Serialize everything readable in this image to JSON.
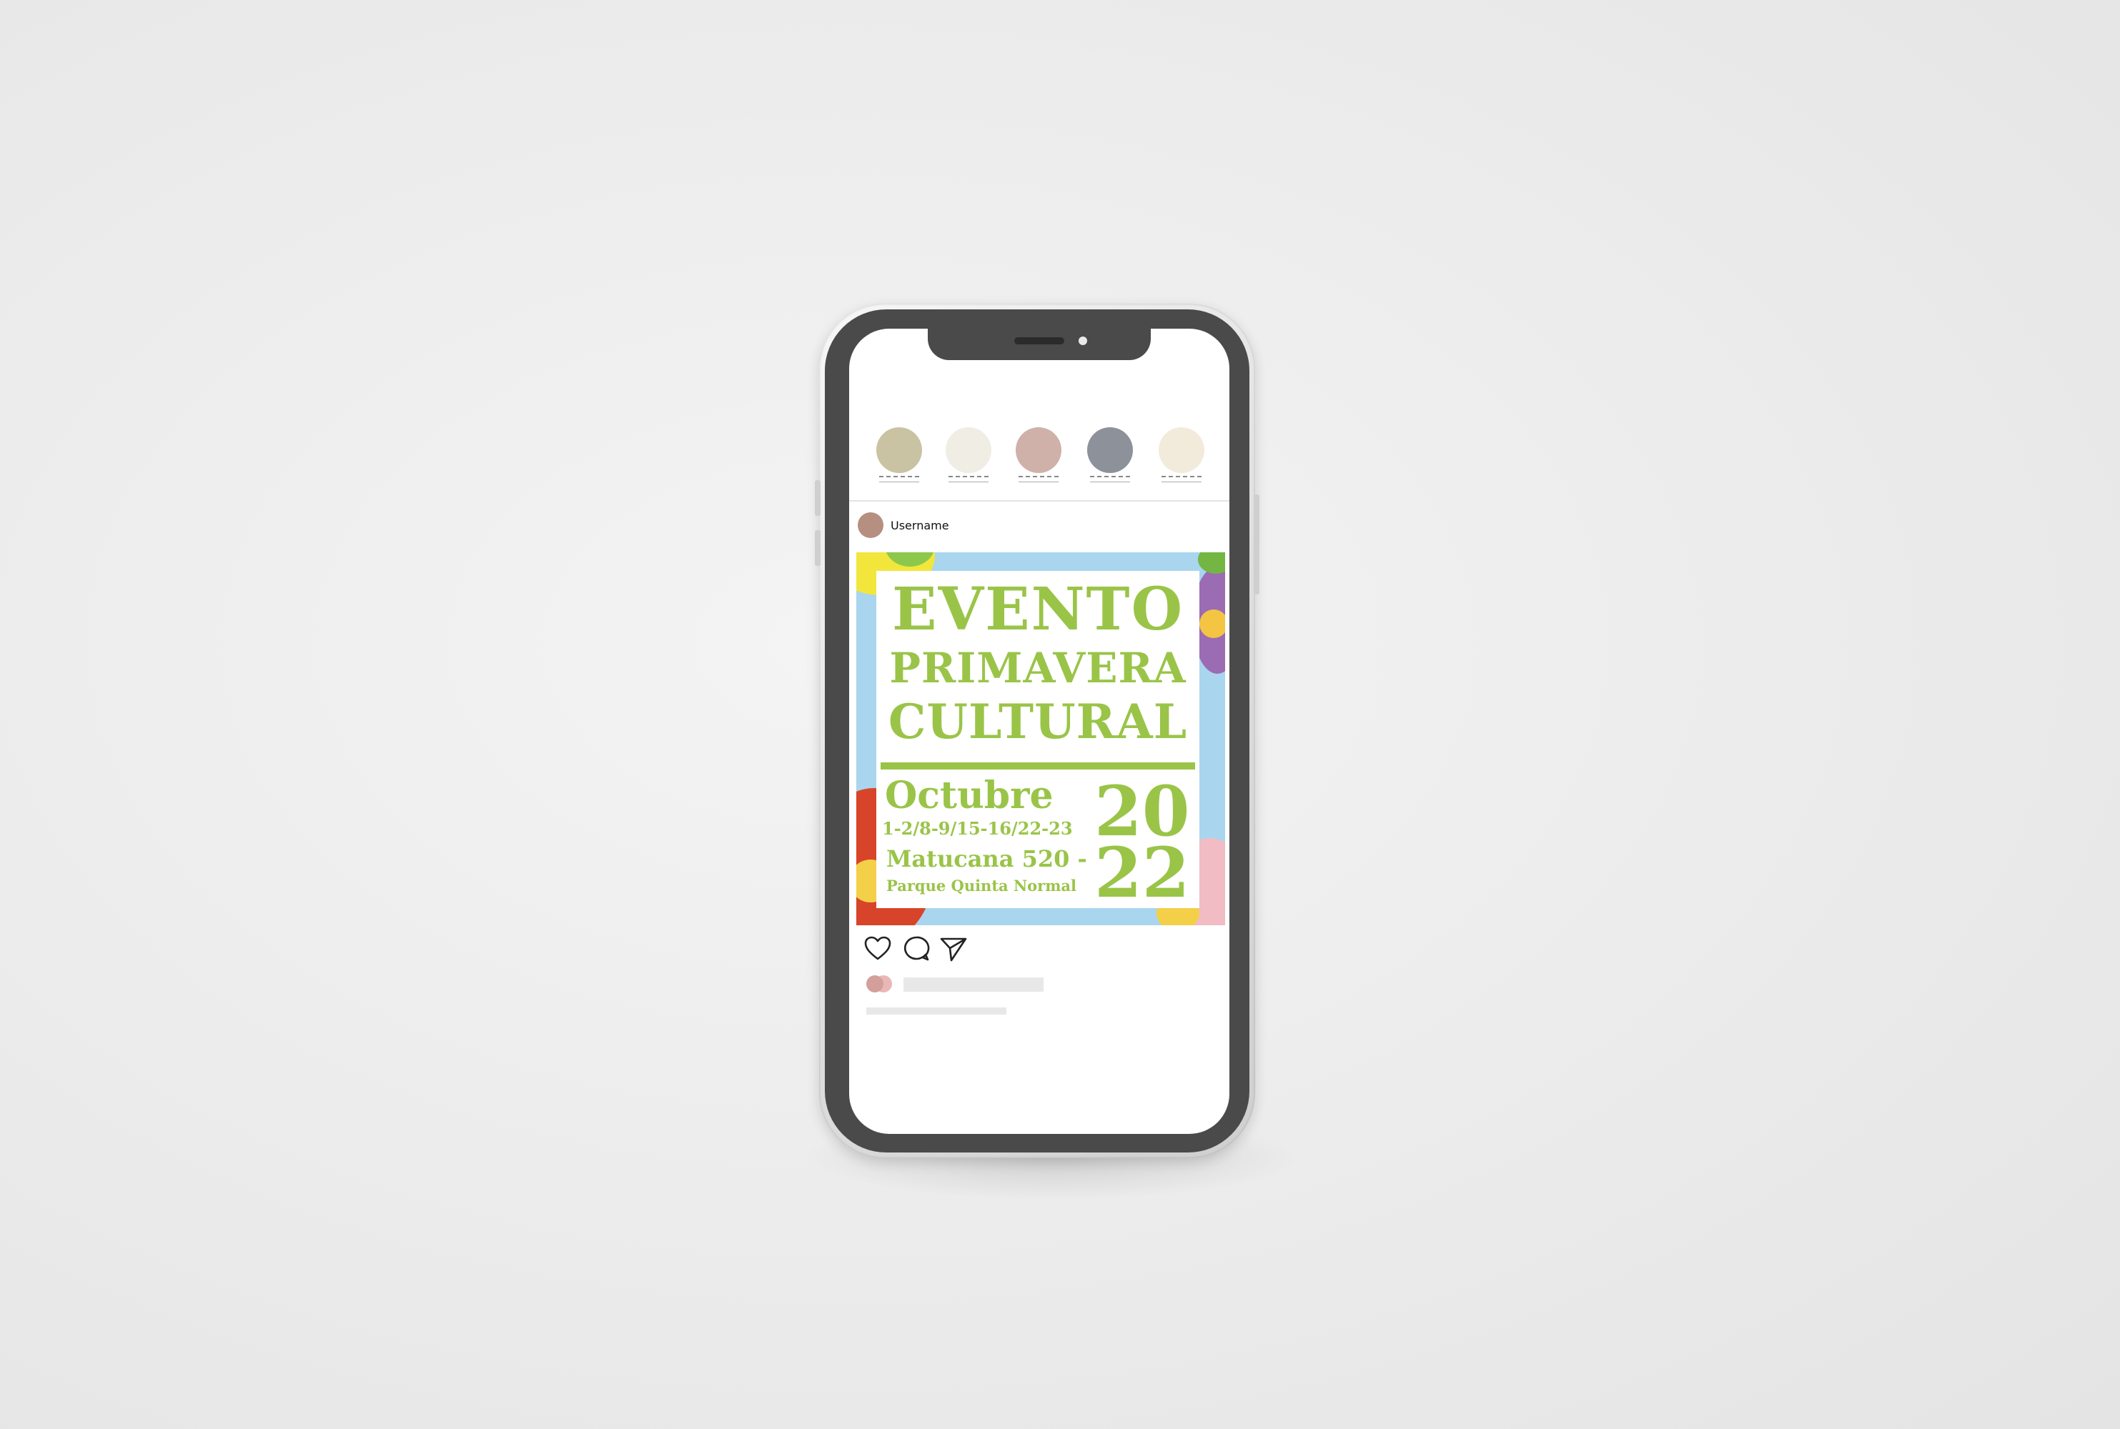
{
  "stories": [
    {
      "color": "#c9c3a3"
    },
    {
      "color": "#efede4"
    },
    {
      "color": "#cfb1a9"
    },
    {
      "color": "#8d9199"
    },
    {
      "color": "#f2ebdb"
    }
  ],
  "post": {
    "username": "Username",
    "avatar_color": "#b58f80"
  },
  "poster": {
    "title_line1": "EVENTO",
    "title_line2": "PRIMAVERA",
    "title_line3": "CULTURAL",
    "month": "Octubre",
    "dates": "1-2/8-9/15-16/22-23",
    "address_line1": "Matucana 520 -",
    "address_line2": "Parque Quinta Normal",
    "year_top": "20",
    "year_bottom": "22",
    "text_color": "#9ac448",
    "background_color": "#a9d5ee"
  },
  "actions": {
    "like_icon": "heart-icon",
    "comment_icon": "comment-icon",
    "share_icon": "paper-plane-icon"
  },
  "likes": {
    "avatar_colors": [
      "#d49f9a",
      "#e9b8b6"
    ]
  }
}
